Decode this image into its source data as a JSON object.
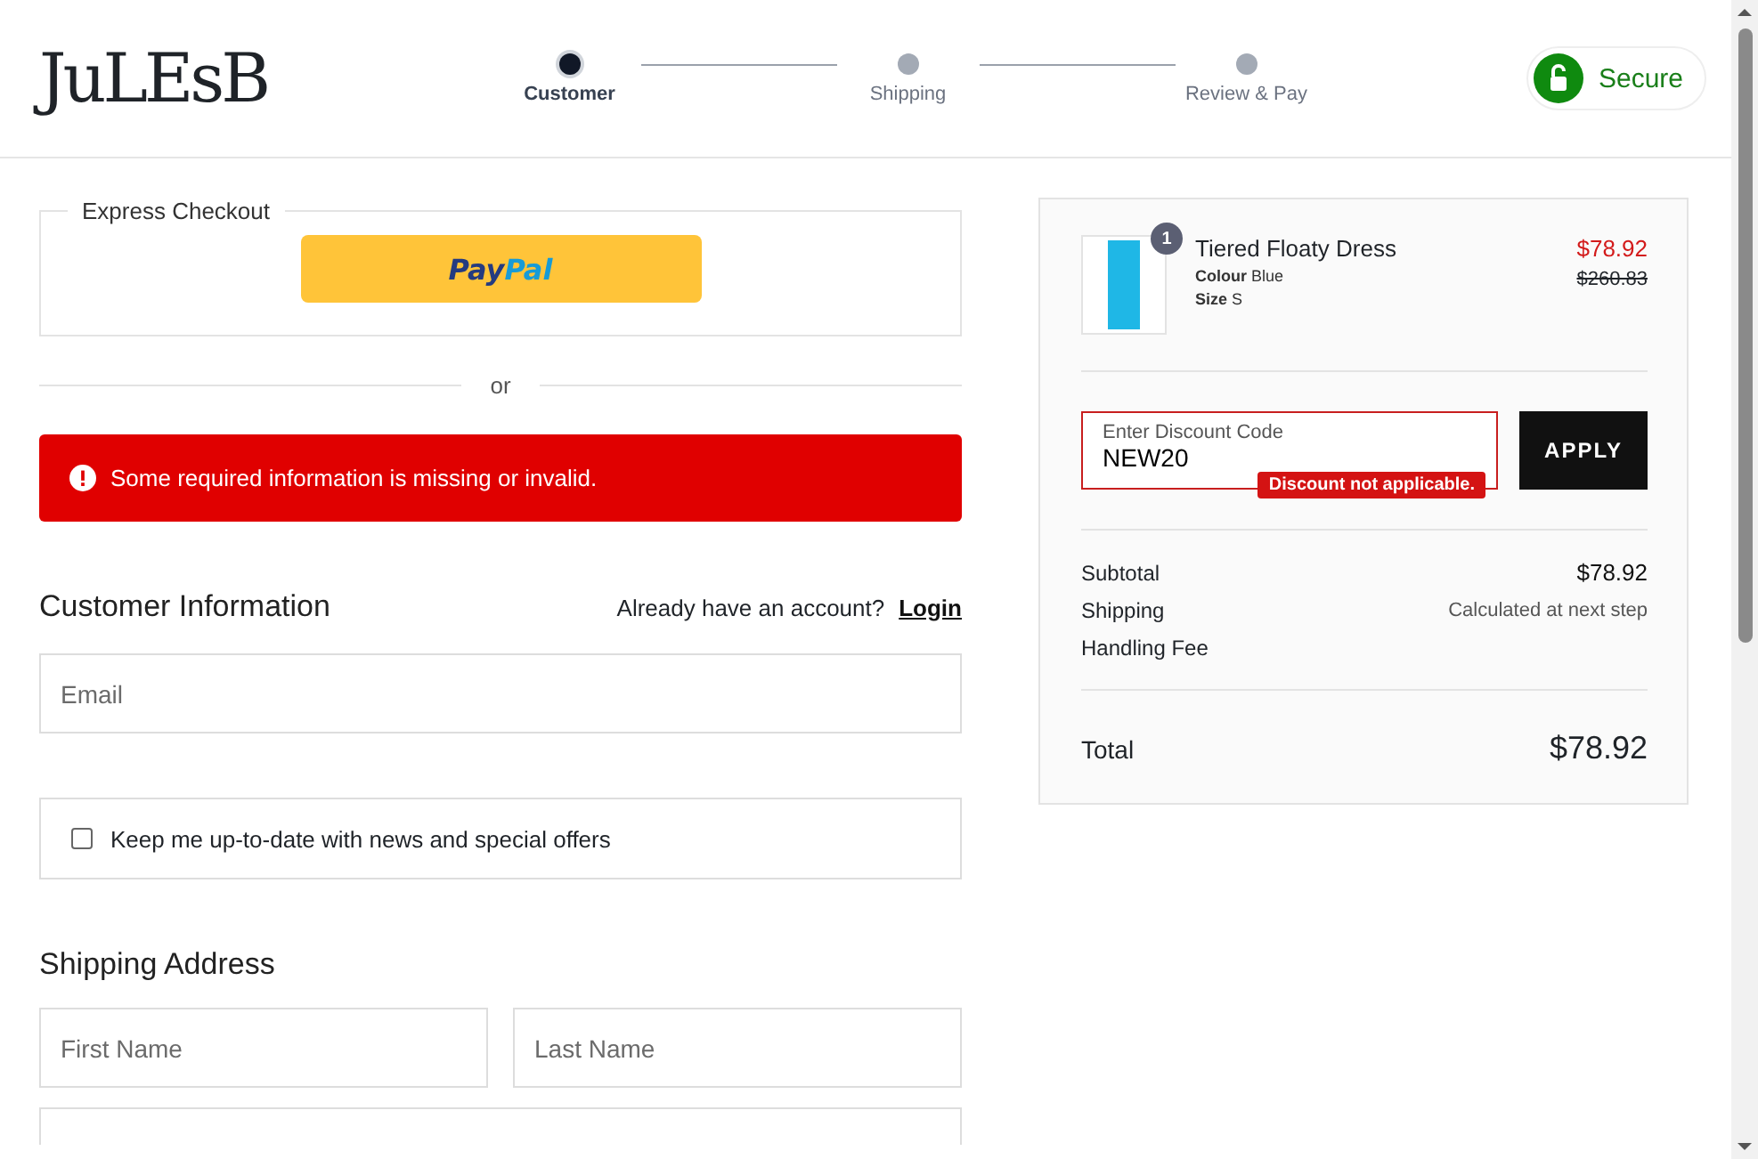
{
  "header": {
    "logo": "JuLEsB",
    "steps": [
      {
        "label": "Customer",
        "selected": true
      },
      {
        "label": "Shipping",
        "selected": false
      },
      {
        "label": "Review & Pay",
        "selected": false
      }
    ],
    "secure": "Secure"
  },
  "express": {
    "legend": "Express Checkout",
    "paypal": [
      "Pay",
      "Pal"
    ]
  },
  "divider": "or",
  "error": "Some required information is missing or invalid.",
  "customer": {
    "title": "Customer Information",
    "account_prompt": "Already have an account?",
    "login": "Login",
    "email_placeholder": "Email",
    "newsletter": {
      "label": "Keep me up-to-date with news and special offers",
      "checked": false
    }
  },
  "shipping": {
    "title": "Shipping Address",
    "fields": [
      {
        "placeholder": "First Name"
      },
      {
        "placeholder": "Last Name"
      }
    ]
  },
  "summary": {
    "item": {
      "name": "Tiered Floaty Dress",
      "quantity": "1",
      "colour_label": "Colour",
      "colour": "Blue",
      "size_label": "Size",
      "size": "S",
      "price": "$78.92",
      "old_price": "$260.83"
    },
    "discount": {
      "label": "Enter Discount Code",
      "value": "NEW20",
      "error": "Discount not applicable.",
      "button": "APPLY"
    },
    "lines": [
      {
        "label": "Subtotal",
        "value": "$78.92",
        "kind": "amount"
      },
      {
        "label": "Shipping",
        "value": "Calculated at next step",
        "kind": "note"
      },
      {
        "label": "Handling Fee",
        "kind": "amount"
      }
    ],
    "total": {
      "label": "Total",
      "value": "$78.92"
    }
  }
}
